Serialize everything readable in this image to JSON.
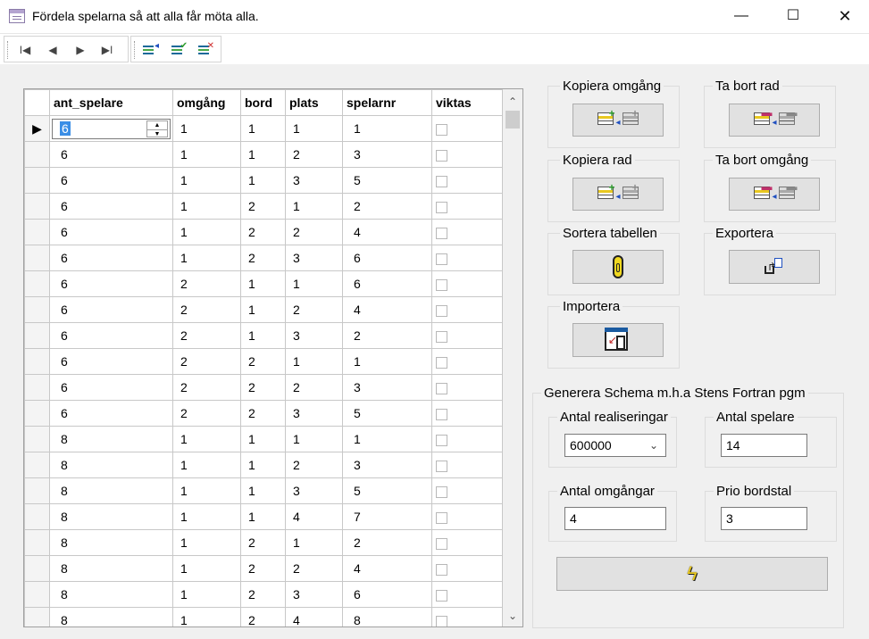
{
  "window": {
    "title": "Fördela spelarna så att alla får möta alla."
  },
  "window_controls": {
    "minimize": "—",
    "maximize": "☐",
    "close": "✕"
  },
  "toolbar": {
    "nav": [
      {
        "icon": "first-record-icon",
        "glyph": "I◀"
      },
      {
        "icon": "previous-record-icon",
        "glyph": "◀"
      },
      {
        "icon": "next-record-icon",
        "glyph": "▶"
      },
      {
        "icon": "last-record-icon",
        "glyph": "▶I"
      }
    ],
    "edit": [
      {
        "icon": "insert-row-icon"
      },
      {
        "icon": "save-row-icon"
      },
      {
        "icon": "delete-row-icon"
      }
    ]
  },
  "grid": {
    "columns": [
      "ant_spelare",
      "omgång",
      "bord",
      "plats",
      "spelarnr",
      "viktas"
    ],
    "current_row_indicator": "▶",
    "rows": [
      [
        "6",
        "1",
        "1",
        "1",
        "1"
      ],
      [
        "6",
        "1",
        "1",
        "2",
        "3"
      ],
      [
        "6",
        "1",
        "1",
        "3",
        "5"
      ],
      [
        "6",
        "1",
        "2",
        "1",
        "2"
      ],
      [
        "6",
        "1",
        "2",
        "2",
        "4"
      ],
      [
        "6",
        "1",
        "2",
        "3",
        "6"
      ],
      [
        "6",
        "2",
        "1",
        "1",
        "6"
      ],
      [
        "6",
        "2",
        "1",
        "2",
        "4"
      ],
      [
        "6",
        "2",
        "1",
        "3",
        "2"
      ],
      [
        "6",
        "2",
        "2",
        "1",
        "1"
      ],
      [
        "6",
        "2",
        "2",
        "2",
        "3"
      ],
      [
        "6",
        "2",
        "2",
        "3",
        "5"
      ],
      [
        "8",
        "1",
        "1",
        "1",
        "1"
      ],
      [
        "8",
        "1",
        "1",
        "2",
        "3"
      ],
      [
        "8",
        "1",
        "1",
        "3",
        "5"
      ],
      [
        "8",
        "1",
        "1",
        "4",
        "7"
      ],
      [
        "8",
        "1",
        "2",
        "1",
        "2"
      ],
      [
        "8",
        "1",
        "2",
        "2",
        "4"
      ],
      [
        "8",
        "1",
        "2",
        "3",
        "6"
      ],
      [
        "8",
        "1",
        "2",
        "4",
        "8"
      ]
    ]
  },
  "panel": {
    "kopiera_omgang": "Kopiera omgång",
    "ta_bort_rad": "Ta bort rad",
    "kopiera_rad": "Kopiera rad",
    "ta_bort_omgang": "Ta bort omgång",
    "sortera": "Sortera tabellen",
    "exportera": "Exportera",
    "importera": "Importera",
    "generera": {
      "title": "Generera Schema m.h.a Stens Fortran pgm",
      "antal_realiseringar_label": "Antal realiseringar",
      "antal_realiseringar_value": "600000",
      "antal_spelare_label": "Antal spelare",
      "antal_spelare_value": "14",
      "antal_omgangar_label": "Antal omgångar",
      "antal_omgangar_value": "4",
      "prio_bordstal_label": "Prio bordstal",
      "prio_bordstal_value": "3"
    }
  }
}
